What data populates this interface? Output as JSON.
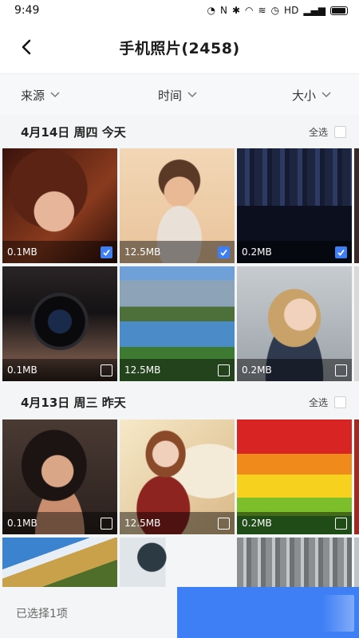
{
  "status_bar": {
    "time": "9:49",
    "icons_text": "HD"
  },
  "header": {
    "title": "手机照片(2458)"
  },
  "filters": [
    {
      "label": "来源"
    },
    {
      "label": "时间"
    },
    {
      "label": "大小"
    }
  ],
  "sections": [
    {
      "title": "4月14日 周四 今天",
      "select_all": "全选",
      "photos": [
        {
          "size": "0.1MB",
          "checked": true,
          "icon": "portrait-photo"
        },
        {
          "size": "12.5MB",
          "checked": true,
          "icon": "child-photo"
        },
        {
          "size": "0.2MB",
          "checked": true,
          "icon": "city-night-photo"
        },
        {
          "size": "0.1MB",
          "checked": false,
          "icon": "camera-photo"
        },
        {
          "size": "12.5MB",
          "checked": false,
          "icon": "mountain-lake-photo"
        },
        {
          "size": "0.2MB",
          "checked": false,
          "icon": "girl-portrait-photo"
        }
      ]
    },
    {
      "title": "4月13日 周三 昨天",
      "select_all": "全选",
      "photos": [
        {
          "size": "0.1MB",
          "checked": false,
          "icon": "woman-portrait-photo"
        },
        {
          "size": "12.5MB",
          "checked": false,
          "icon": "girl-flowers-photo"
        },
        {
          "size": "0.2MB",
          "checked": false,
          "icon": "fruit-photo"
        },
        {
          "size": "",
          "checked": false,
          "icon": "mountain-photo"
        },
        {
          "size": "",
          "checked": false,
          "icon": "person-photo"
        },
        {
          "size": "",
          "checked": false,
          "icon": "building-photo"
        }
      ]
    }
  ],
  "bottom_bar": {
    "selected_text": "已选择1项"
  },
  "colors": {
    "accent": "#3f7ff5"
  }
}
